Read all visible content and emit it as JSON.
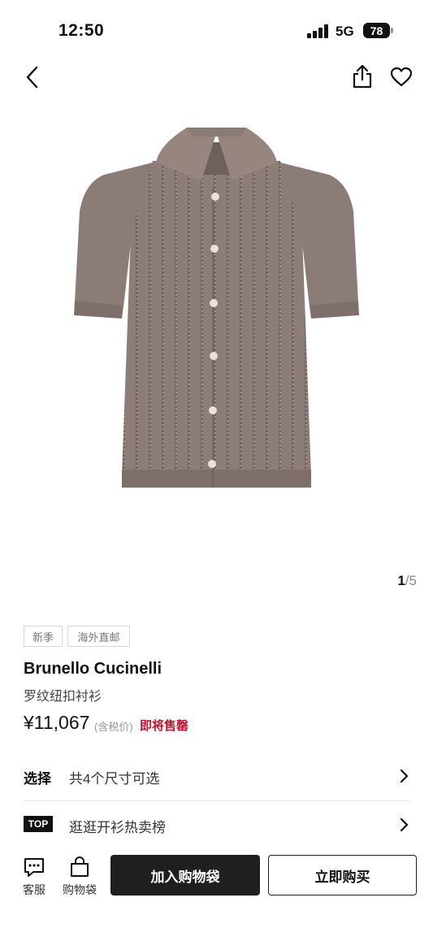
{
  "status_bar": {
    "time": "12:50",
    "network": "5G",
    "battery": "78"
  },
  "nav": {
    "back_icon": "chevron-left-icon",
    "share_icon": "share-icon",
    "favorite_icon": "heart-icon"
  },
  "gallery": {
    "current": "1",
    "separator": "/",
    "total": "5"
  },
  "tags": [
    "新季",
    "海外直邮"
  ],
  "product": {
    "brand": "Brunello Cucinelli",
    "name": "罗纹纽扣衬衫",
    "price": "¥11,067",
    "tax_note": "(含税价)",
    "status": "即将售罄"
  },
  "rows": {
    "select": {
      "label": "选择",
      "text": "共4个尺寸可选"
    },
    "top": {
      "badge": "TOP",
      "text": "逛逛开衫热卖榜"
    }
  },
  "bottom_bar": {
    "service_label": "客服",
    "bag_label": "购物袋",
    "add_to_cart": "加入购物袋",
    "buy_now": "立即购买"
  },
  "colors": {
    "accent_red": "#c8102e",
    "button_dark": "#1f1f1f",
    "shirt": "#8c7b77"
  }
}
